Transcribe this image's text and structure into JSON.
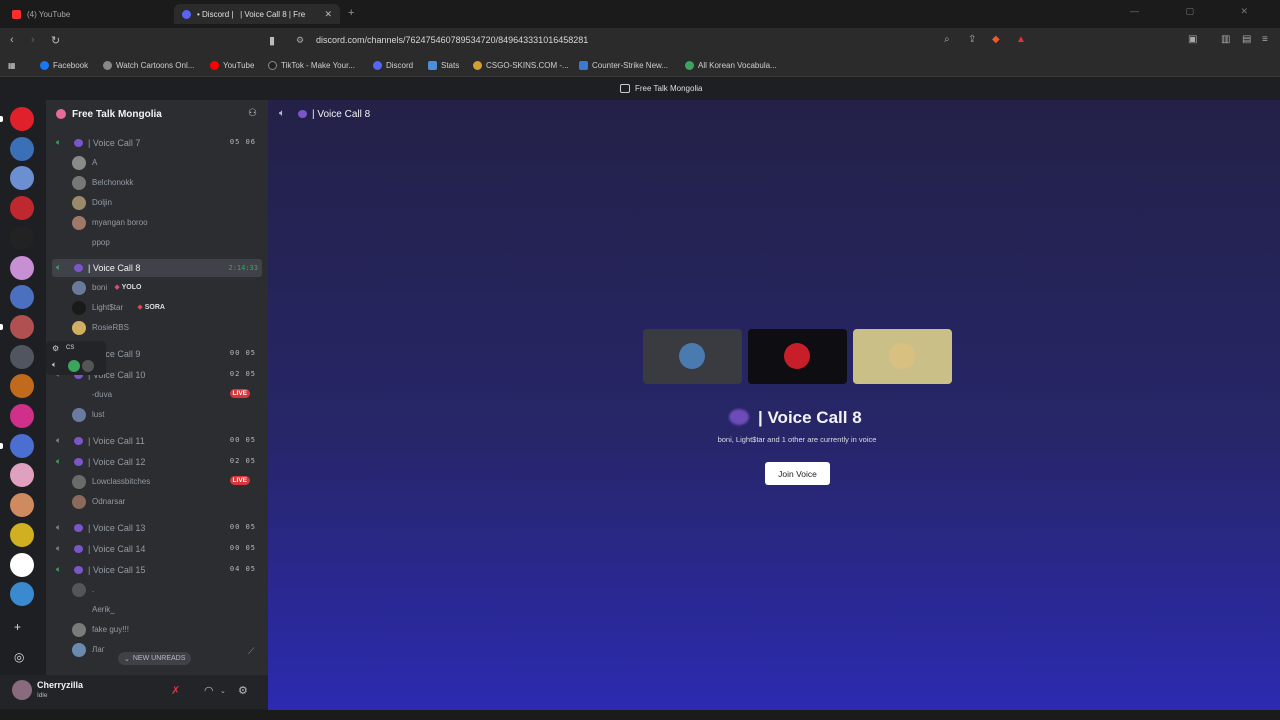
{
  "browser": {
    "tabs": [
      {
        "label": "(4) YouTube",
        "color": "#ff2d2d"
      },
      {
        "label": "• Discord |   | Voice Call 8 | Fre",
        "color": "#5865f2"
      }
    ],
    "new_tab": "+",
    "window_controls": "— ▢ ✕",
    "url": "discord.com/channels/762475460789534720/849643331016458281",
    "bookmarks": [
      {
        "label": "Facebook",
        "color": "#1877f2"
      },
      {
        "label": "Watch Cartoons Onl...",
        "color": "#888888"
      },
      {
        "label": "YouTube",
        "color": "#ff0000"
      },
      {
        "label": "TikTok - Make Your...",
        "color": "#222222"
      },
      {
        "label": "Discord",
        "color": "#5865f2"
      },
      {
        "label": "Stats",
        "color": "#4a8fd8"
      },
      {
        "label": "CSGO-SKINS.COM -...",
        "color": "#d0a030"
      },
      {
        "label": "Counter-Strike New...",
        "color": "#3a7ad0"
      },
      {
        "label": "All Korean Vocabula...",
        "color": "#3ba55d"
      }
    ]
  },
  "discord_title": "Free Talk Mongolia",
  "guild": {
    "name": "Free Talk Mongolia"
  },
  "rail": {
    "servers": [
      "#e0202a",
      "#3b6fb6",
      "#6b8fd0",
      "#c0282f",
      "#222222",
      "#c98fd4",
      "#4b70c0",
      "#b05050",
      "#505560",
      "#c06a1e",
      "#d0308a",
      "#4a6fd0",
      "#e0a0c0",
      "#d08a60",
      "#d0b020",
      "#ffffff",
      "#3a8ad0"
    ],
    "add_icon": "+",
    "discover_icon": "◎"
  },
  "channels": [
    {
      "name": "| Voice Call 7",
      "count": "05 06",
      "active": false,
      "live_speaker": true,
      "users": [
        {
          "name": "A",
          "color": "#8a8a8a"
        },
        {
          "name": "Belchonokk",
          "color": "#777"
        },
        {
          "name": "Doljin",
          "color": "#9a8a6a"
        },
        {
          "name": "myangan boroo",
          "color": "#a0786a"
        },
        {
          "name": "ppop",
          "color": "#2b2d31"
        }
      ]
    },
    {
      "name": "| Voice Call 8",
      "timer": "2:14:33",
      "active": true,
      "live_speaker": true,
      "users": [
        {
          "name": "boni",
          "tag": "YOLO",
          "tag_color": "#e04a7a",
          "color": "#6a7a9a"
        },
        {
          "name": "Light$tar",
          "tag": "SORA",
          "tag_color": "#e04a4a",
          "color": "#1a1a1a"
        },
        {
          "name": "RosieRBS",
          "color": "#d0b060"
        }
      ]
    },
    {
      "name": "| Voice Call 9",
      "count": "00 05",
      "active": false,
      "live_speaker": true,
      "users": []
    },
    {
      "name": "| Voice Call 10",
      "count": "02 05",
      "active": false,
      "live_speaker": true,
      "users": [
        {
          "name": "-duva",
          "color": "#2b2d31",
          "live": "LIVE"
        },
        {
          "name": "lust",
          "color": "#6a7aa0"
        }
      ]
    },
    {
      "name": "| Voice Call 11",
      "count": "00 05",
      "active": false,
      "live_speaker": false,
      "users": []
    },
    {
      "name": "| Voice Call 12",
      "count": "02 05",
      "active": false,
      "live_speaker": true,
      "users": [
        {
          "name": "Lowclassbitches",
          "color": "#6a6a6a",
          "live": "LIVE"
        },
        {
          "name": "Odnarsar",
          "color": "#8a6a5a"
        }
      ]
    },
    {
      "name": "| Voice Call 13",
      "count": "00 05",
      "active": false,
      "live_speaker": false,
      "users": []
    },
    {
      "name": "| Voice Call 14",
      "count": "00 05",
      "active": false,
      "live_speaker": false,
      "users": []
    },
    {
      "name": "| Voice Call 15",
      "count": "04 05",
      "active": false,
      "live_speaker": true,
      "users": [
        {
          "name": ".",
          "color": "#555"
        },
        {
          "name": "Aerik_",
          "color": "#2b2d31"
        },
        {
          "name": "fake guy!!!",
          "color": "#7a7a7a"
        },
        {
          "name": "Лаг",
          "color": "#6a8ab0"
        }
      ]
    }
  ],
  "hovercard": {
    "label": "CS"
  },
  "new_unreads": "NEW UNREADS",
  "user": {
    "name": "Cherryzilla",
    "status": "Idle"
  },
  "controls": {
    "mic_icon": "✗",
    "headset_icon": "◠",
    "settings_icon": "⚙"
  },
  "main": {
    "header_name": "| Voice Call 8",
    "tile_colors": [
      "#3a3b40",
      "#0d0d12",
      "#cbbf88"
    ],
    "tile_avatar_colors": [
      "#4a7ab0",
      "#c81e2a",
      "#d8c080"
    ],
    "title": "| Voice Call 8",
    "subtitle": "boni, Light$tar and 1 other are currently in voice",
    "join_label": "Join Voice"
  }
}
